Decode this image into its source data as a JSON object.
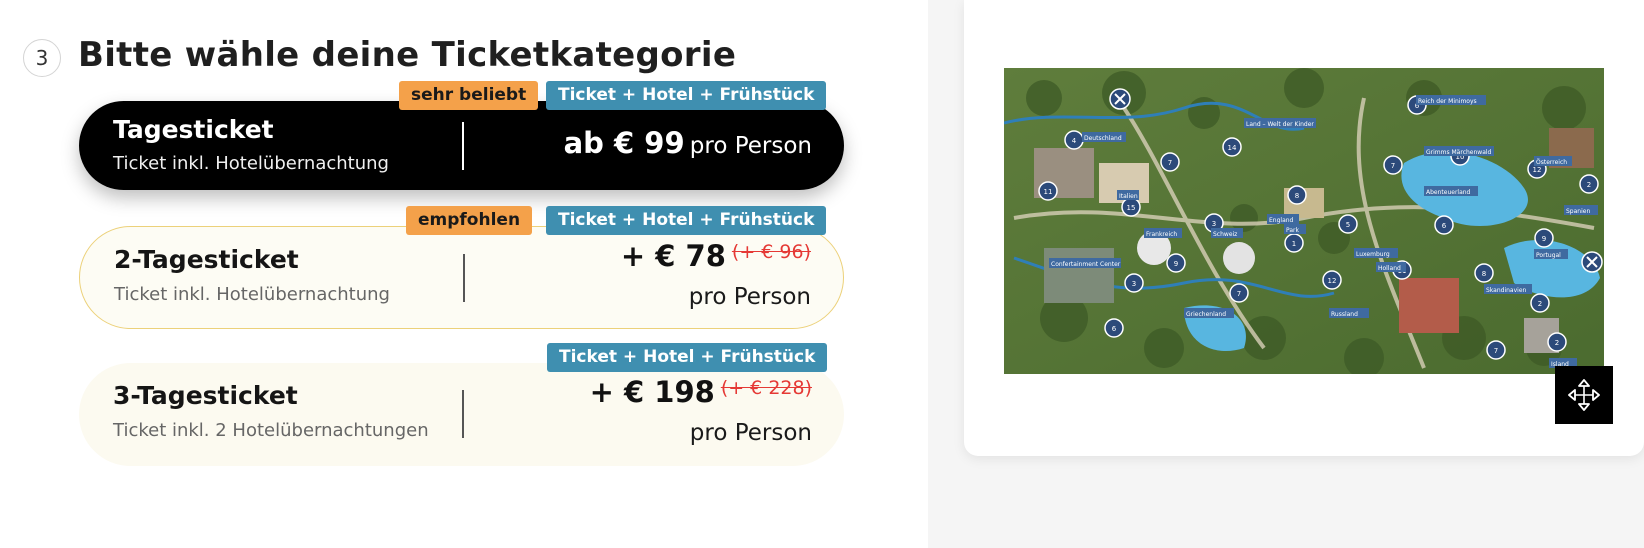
{
  "step": {
    "number": "3",
    "title": "Bitte wähle deine Ticketkategorie"
  },
  "cards": [
    {
      "name": "Tagesticket",
      "subtitle": "Ticket inkl. Hotelübernachtung",
      "price_prefix": "ab € 99",
      "price_unit": "pro Person",
      "badge_highlight": "sehr beliebt",
      "badge_package": "Ticket + Hotel + Frühstück",
      "selected": true
    },
    {
      "name": "2-Tagesticket",
      "subtitle": "Ticket inkl. Hotelübernachtung",
      "price": "+ € 78",
      "old_price": "(+ € 96)",
      "price_unit": "pro Person",
      "badge_highlight": "empfohlen",
      "badge_package": "Ticket + Hotel + Frühstück"
    },
    {
      "name": "3-Tagesticket",
      "subtitle": "Ticket inkl. 2 Hotelübernachtungen",
      "price": "+ € 198",
      "old_price": "(+ € 228)",
      "price_unit": "pro Person",
      "badge_package": "Ticket + Hotel + Frühstück"
    }
  ],
  "map": {
    "labels": [
      "Deutschland",
      "Land – Welt der Kinder",
      "Reich der Minimoys",
      "Grimms Märchenwald",
      "Abenteuerland",
      "Österreich",
      "Spanien",
      "Portugal",
      "Skandinavien",
      "Island",
      "Holland",
      "Luxemburg",
      "Russland",
      "Griechenland",
      "Frankreich",
      "Schweiz",
      "England",
      "Park",
      "Confertainment Center",
      "Italien"
    ],
    "markers": [
      "4",
      "7",
      "11",
      "14",
      "15",
      "6",
      "10",
      "12",
      "2",
      "8",
      "5",
      "1",
      "9",
      "3",
      "13",
      "7",
      "12",
      "11",
      "6",
      "8",
      "9",
      "2",
      "7",
      "2",
      "3",
      "7",
      "6"
    ],
    "expand_icon": "expand-arrows-icon",
    "close_icon": "close-x-icon"
  },
  "colors": {
    "card_selected_bg": "#000000",
    "card_bg": "#fcfaf0",
    "card_border_recommended": "#ecd17a",
    "badge_highlight": "#f4a14a",
    "badge_package": "#3f8fb0",
    "old_price": "#e53935"
  }
}
